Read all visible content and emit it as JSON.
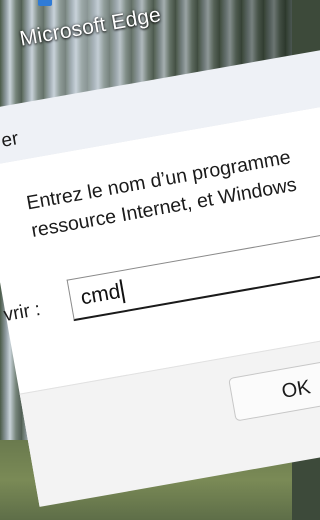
{
  "desktop": {
    "icon_name": "edge-icon",
    "icon_label": "Microsoft Edge"
  },
  "run_dialog": {
    "title": "er",
    "instruction_line1": "Entrez le nom d’un programme",
    "instruction_line2": "ressource Internet, et Windows",
    "open_label": "vrir :",
    "open_value": "cmd",
    "ok_label": "OK"
  },
  "colors": {
    "accent": "#2f7bd6",
    "dialog_bg": "#ffffff",
    "footer_bg": "#f3f3f3"
  }
}
